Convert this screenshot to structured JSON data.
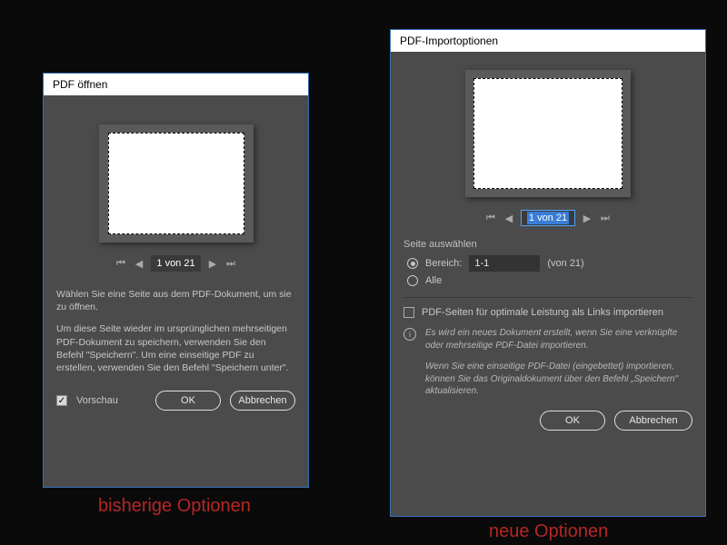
{
  "left": {
    "title": "PDF öffnen",
    "pager": {
      "value": "1 von 21",
      "first": "⏮",
      "prev": "◀",
      "next": "▶",
      "last": "⏭"
    },
    "text1": "Wählen Sie eine Seite aus dem PDF-Dokument, um sie zu öffnen.",
    "text2": "Um diese Seite wieder im ursprünglichen mehrseitigen PDF-Dokument zu speichern, verwenden Sie den Befehl \"Speichern\". Um eine einseitige PDF zu erstellen, verwenden Sie den Befehl \"Speichern unter\".",
    "preview_label": "Vorschau",
    "ok_label": "OK",
    "cancel_label": "Abbrechen"
  },
  "right": {
    "title": "PDF-Importoptionen",
    "pager": {
      "value": "1 von 21",
      "first": "⏮",
      "prev": "◀",
      "next": "▶",
      "last": "⏭"
    },
    "select_label": "Seite auswählen",
    "range_label": "Bereich:",
    "range_value": "1-1",
    "range_total": "(von 21)",
    "all_label": "Alle",
    "import_label": "PDF-Seiten für optimale Leistung als Links importieren",
    "info1": "Es wird ein neues Dokument erstellt, wenn Sie eine verknüpfte oder mehrseitige PDF-Datei importieren.",
    "info2": "Wenn Sie eine einseitige PDF-Datei (eingebettet) importieren, können Sie das Originaldokument über den Befehl „Speichern\" aktualisieren.",
    "ok_label": "OK",
    "cancel_label": "Abbrechen"
  },
  "captions": {
    "left": "bisherige Optionen",
    "right": "neue Optionen"
  }
}
